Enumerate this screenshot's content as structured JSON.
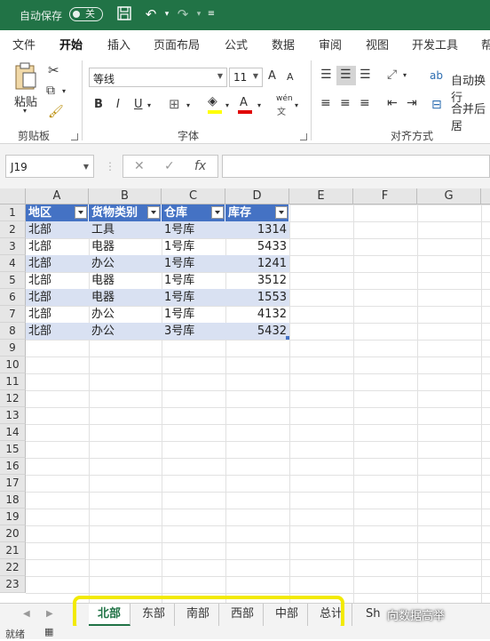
{
  "titlebar": {
    "autosave_label": "自动保存",
    "toggle_state": "关"
  },
  "ribbon_tabs": [
    "文件",
    "开始",
    "插入",
    "页面布局",
    "公式",
    "数据",
    "审阅",
    "视图",
    "开发工具",
    "帮"
  ],
  "ribbon": {
    "clipboard": {
      "paste_label": "粘贴",
      "group_label": "剪贴板"
    },
    "font": {
      "font_name": "等线",
      "font_size": "11",
      "grow": "A",
      "shrink": "A",
      "bold": "B",
      "italic": "I",
      "underline": "U",
      "phonetic": "wén",
      "group_label": "字体"
    },
    "alignment": {
      "wrap_label": "自动换行",
      "merge_label": "合并后居",
      "group_label": "对齐方式"
    }
  },
  "formula_bar": {
    "name_box": "J19",
    "cancel": "✕",
    "enter": "✓",
    "fx": "fx",
    "formula": ""
  },
  "columns": [
    "A",
    "B",
    "C",
    "D",
    "E",
    "F",
    "G"
  ],
  "rows": [
    "1",
    "2",
    "3",
    "4",
    "5",
    "6",
    "7",
    "8",
    "9",
    "10",
    "11",
    "12",
    "13",
    "14",
    "15",
    "16",
    "17",
    "18",
    "19",
    "20",
    "21",
    "22",
    "23"
  ],
  "table": {
    "headers": [
      "地区",
      "货物类别",
      "仓库",
      "库存"
    ],
    "rows": [
      [
        "北部",
        "工具",
        "1号库",
        "1314"
      ],
      [
        "北部",
        "电器",
        "1号库",
        "5433"
      ],
      [
        "北部",
        "办公",
        "1号库",
        "1241"
      ],
      [
        "北部",
        "电器",
        "1号库",
        "3512"
      ],
      [
        "北部",
        "电器",
        "1号库",
        "1553"
      ],
      [
        "北部",
        "办公",
        "1号库",
        "4132"
      ],
      [
        "北部",
        "办公",
        "3号库",
        "5432"
      ]
    ]
  },
  "sheet_tabs": [
    "北部",
    "东部",
    "南部",
    "西部",
    "中部",
    "总计",
    "Sh"
  ],
  "active_sheet": "北部",
  "status": {
    "ready": "就绪"
  },
  "watermark": "向数据高举",
  "colors": {
    "excel_green": "#217346",
    "table_header": "#4472c4",
    "band": "#d9e1f2",
    "highlight": "#f2ea00"
  }
}
